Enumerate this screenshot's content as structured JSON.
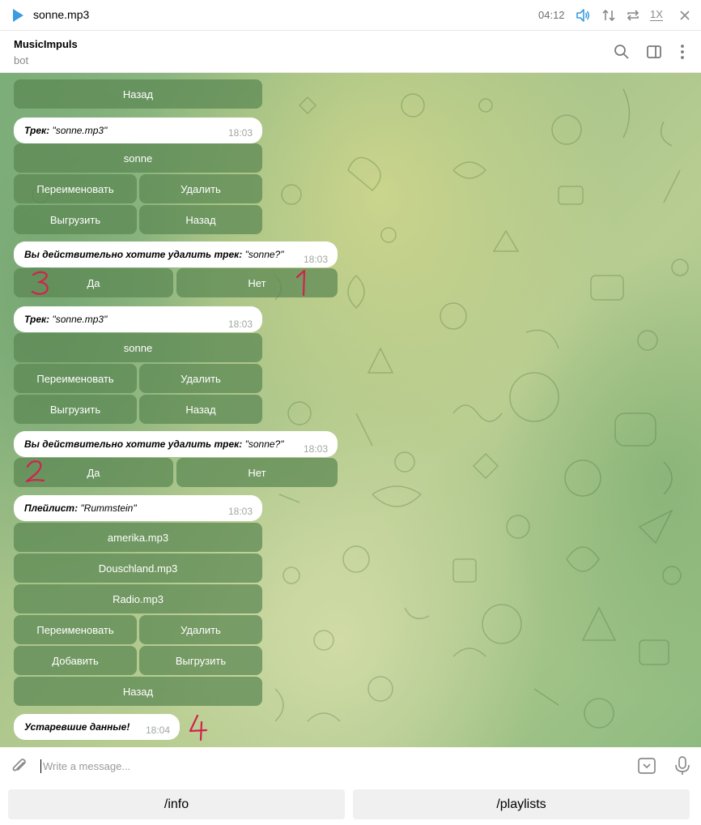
{
  "player": {
    "track": "sonne.mp3",
    "time": "04:12",
    "speed": "1X",
    "accent": "#3b9be0"
  },
  "header": {
    "name": "MusicImpuls",
    "status": "bot"
  },
  "messages": {
    "m0": {
      "back": "Назад"
    },
    "m1": {
      "label": "Трек:",
      "value": " \"sonne.mp3\"",
      "time": "18:03",
      "btn_title": "sonne",
      "btn_rename": "Переименовать",
      "btn_delete": "Удалить",
      "btn_export": "Выгрузить",
      "btn_back": "Назад"
    },
    "m2": {
      "label": "Вы действительно хотите удалить трек:",
      "value": " \"sonne?\"",
      "time": "18:03",
      "btn_yes": "Да",
      "btn_no": "Нет"
    },
    "m3": {
      "label": "Трек:",
      "value": " \"sonne.mp3\"",
      "time": "18:03",
      "btn_title": "sonne",
      "btn_rename": "Переименовать",
      "btn_delete": "Удалить",
      "btn_export": "Выгрузить",
      "btn_back": "Назад"
    },
    "m4": {
      "label": "Вы действительно хотите удалить трек:",
      "value": " \"sonne?\"",
      "time": "18:03",
      "btn_yes": "Да",
      "btn_no": "Нет"
    },
    "m5": {
      "label": "Плейлист:",
      "value": " \"Rummstein\"",
      "time": "18:03",
      "tracks": [
        "amerika.mp3",
        "Douschland.mp3",
        "Radio.mp3"
      ],
      "btn_rename": "Переименовать",
      "btn_delete": "Удалить",
      "btn_add": "Добавить",
      "btn_export": "Выгрузить",
      "btn_back": "Назад"
    },
    "m6": {
      "label": "Устаревшие данные!",
      "time": "18:04"
    }
  },
  "annotations": {
    "a1": "1",
    "a2": "2",
    "a3": "3",
    "a4": "4",
    "color": "#d1224f"
  },
  "input": {
    "placeholder": "Write a message..."
  },
  "bot_keyboard": {
    "info": "/info",
    "playlists": "/playlists"
  }
}
